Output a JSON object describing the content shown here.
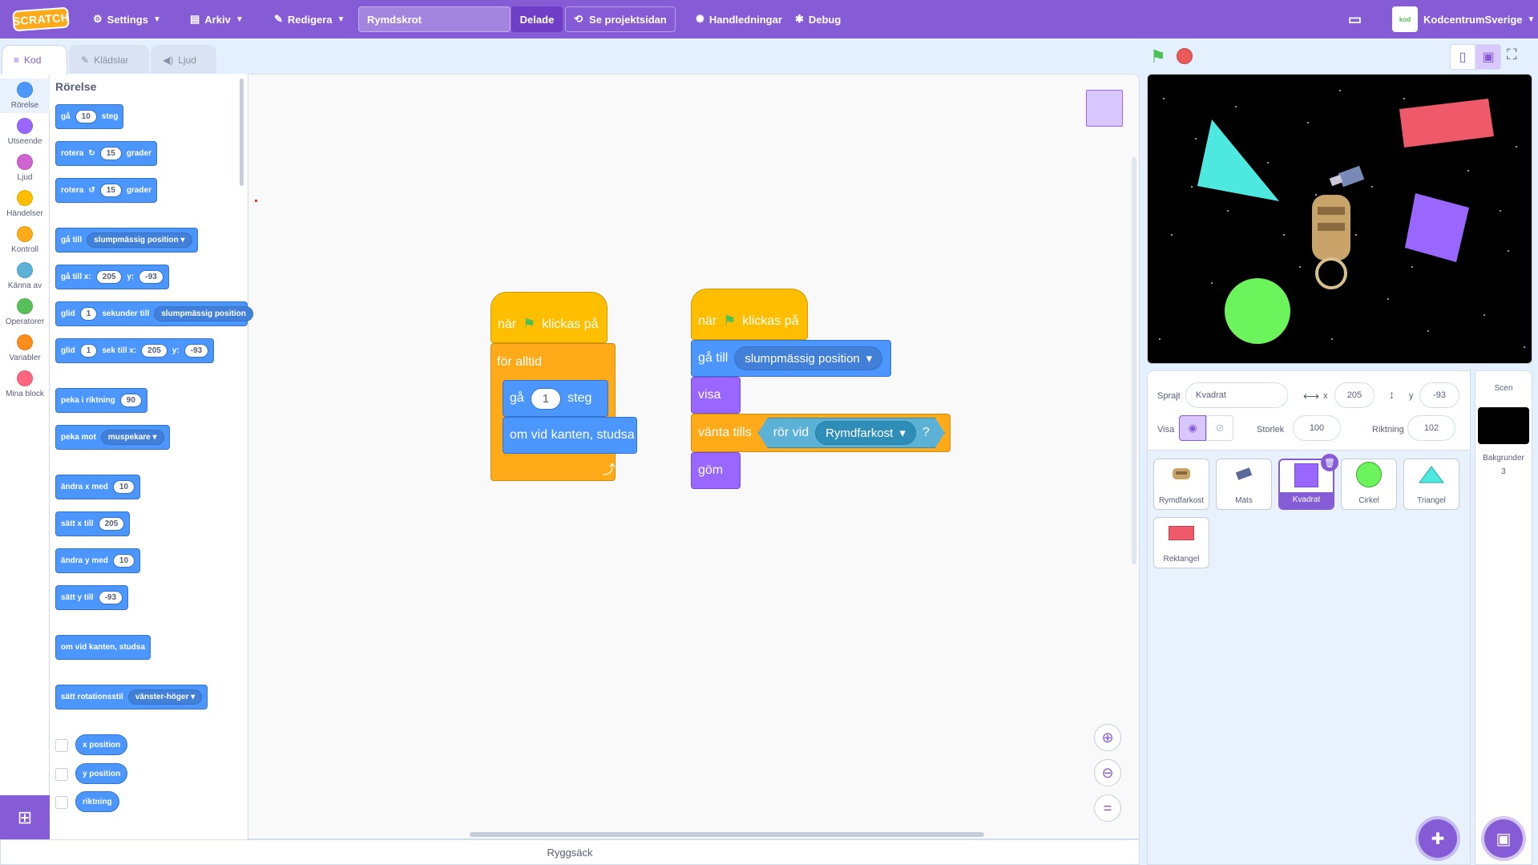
{
  "menubar": {
    "logo": "SCRATCH",
    "settings": "Settings",
    "file": "Arkiv",
    "edit": "Redigera",
    "project_title": "Rymdskrot",
    "share": "Delade",
    "see_project": "Se projektsidan",
    "tutorials": "Handledningar",
    "debug": "Debug",
    "username": "KodcentrumSverige"
  },
  "tabs": {
    "code": "Kod",
    "costumes": "Klädslar",
    "sounds": "Ljud"
  },
  "categories": [
    {
      "label": "Rörelse",
      "color": "#4c97ff"
    },
    {
      "label": "Utseende",
      "color": "#9966ff"
    },
    {
      "label": "Ljud",
      "color": "#cf63cf"
    },
    {
      "label": "Händelser",
      "color": "#ffbf00"
    },
    {
      "label": "Kontroll",
      "color": "#ffab19"
    },
    {
      "label": "Känna av",
      "color": "#5cb1d6"
    },
    {
      "label": "Operatorer",
      "color": "#59c059"
    },
    {
      "label": "Variabler",
      "color": "#ff8c1a"
    },
    {
      "label": "Mina block",
      "color": "#ff6680"
    }
  ],
  "palette": {
    "title": "Rörelse",
    "move": {
      "pre": "gå",
      "val": "10",
      "post": "steg"
    },
    "turn_right": {
      "pre": "rotera",
      "val": "15",
      "post": "grader"
    },
    "turn_left": {
      "pre": "rotera",
      "val": "15",
      "post": "grader"
    },
    "goto": {
      "pre": "gå till",
      "dd": "slumpmässig position"
    },
    "goto_xy": {
      "pre": "gå till x:",
      "x": "205",
      "ymid": "y:",
      "y": "-93"
    },
    "glide_to": {
      "pre": "glid",
      "val": "1",
      "mid": "sekunder till",
      "dd": "slumpmässig position"
    },
    "glide_xy": {
      "pre": "glid",
      "val": "1",
      "mid": "sek till x:",
      "x": "205",
      "ymid": "y:",
      "y": "-93"
    },
    "point_dir": {
      "pre": "peka i riktning",
      "val": "90"
    },
    "point_towards": {
      "pre": "peka mot",
      "dd": "muspekare"
    },
    "change_x": {
      "pre": "ändra x med",
      "val": "10"
    },
    "set_x": {
      "pre": "sätt x till",
      "val": "205"
    },
    "change_y": {
      "pre": "ändra y med",
      "val": "10"
    },
    "set_y": {
      "pre": "sätt y till",
      "val": "-93"
    },
    "bounce": "om vid kanten, studsa",
    "rot_style": {
      "pre": "sätt rotationsstil",
      "dd": "vänster-höger"
    },
    "reporters": [
      "x position",
      "y position",
      "riktning"
    ]
  },
  "script1": {
    "hat": {
      "pre": "när",
      "post": "klickas på"
    },
    "forever": "för alltid",
    "move": {
      "pre": "gå",
      "val": "1",
      "post": "steg"
    },
    "bounce": "om vid kanten, studsa"
  },
  "script2": {
    "hat": {
      "pre": "när",
      "post": "klickas på"
    },
    "goto": {
      "pre": "gå till",
      "dd": "slumpmässig position"
    },
    "show": "visa",
    "wait_until": "vänta tills",
    "touching": {
      "pre": "rör vid",
      "dd": "Rymdfarkost",
      "q": "?"
    },
    "hide": "göm"
  },
  "backpack": "Ryggsäck",
  "sprite_info": {
    "sprite_label": "Sprajt",
    "sprite_name": "Kvadrat",
    "x_label": "x",
    "x": "205",
    "y_label": "y",
    "y": "-93",
    "show_label": "Visa",
    "size_label": "Storlek",
    "size": "100",
    "dir_label": "Riktning",
    "dir": "102"
  },
  "sprites": [
    {
      "name": "Rymdfarkost",
      "icon": "spacecraft-icon"
    },
    {
      "name": "Mats",
      "icon": "satellite-icon"
    },
    {
      "name": "Kvadrat",
      "icon": "square-icon"
    },
    {
      "name": "Cirkel",
      "icon": "circle-icon"
    },
    {
      "name": "Triangel",
      "icon": "triangle-icon"
    },
    {
      "name": "Rektangel",
      "icon": "rectangle-icon"
    }
  ],
  "stage_pane": {
    "title": "Scen",
    "backdrops_label": "Bakgrunder",
    "backdrops_count": "3"
  },
  "colors": {
    "accent": "#855cd6",
    "motion": "#4c97ff",
    "events": "#ffbf00",
    "control": "#ffab19",
    "looks": "#9966ff",
    "sensing": "#5cb1d6"
  }
}
